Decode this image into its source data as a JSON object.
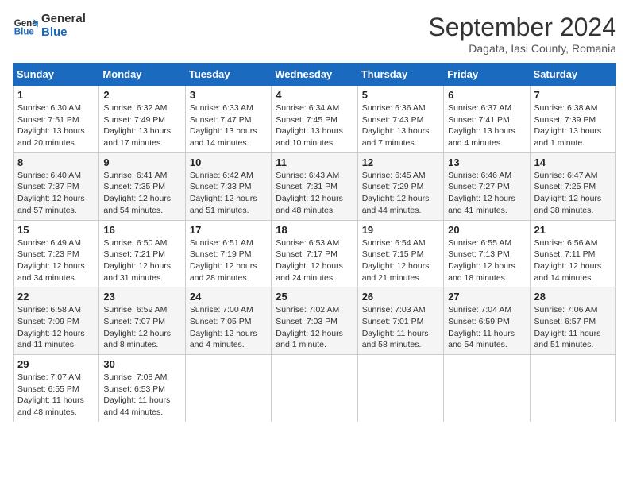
{
  "header": {
    "logo_general": "General",
    "logo_blue": "Blue",
    "month_title": "September 2024",
    "location": "Dagata, Iasi County, Romania"
  },
  "weekdays": [
    "Sunday",
    "Monday",
    "Tuesday",
    "Wednesday",
    "Thursday",
    "Friday",
    "Saturday"
  ],
  "weeks": [
    [
      {
        "day": "1",
        "info": "Sunrise: 6:30 AM\nSunset: 7:51 PM\nDaylight: 13 hours\nand 20 minutes."
      },
      {
        "day": "2",
        "info": "Sunrise: 6:32 AM\nSunset: 7:49 PM\nDaylight: 13 hours\nand 17 minutes."
      },
      {
        "day": "3",
        "info": "Sunrise: 6:33 AM\nSunset: 7:47 PM\nDaylight: 13 hours\nand 14 minutes."
      },
      {
        "day": "4",
        "info": "Sunrise: 6:34 AM\nSunset: 7:45 PM\nDaylight: 13 hours\nand 10 minutes."
      },
      {
        "day": "5",
        "info": "Sunrise: 6:36 AM\nSunset: 7:43 PM\nDaylight: 13 hours\nand 7 minutes."
      },
      {
        "day": "6",
        "info": "Sunrise: 6:37 AM\nSunset: 7:41 PM\nDaylight: 13 hours\nand 4 minutes."
      },
      {
        "day": "7",
        "info": "Sunrise: 6:38 AM\nSunset: 7:39 PM\nDaylight: 13 hours\nand 1 minute."
      }
    ],
    [
      {
        "day": "8",
        "info": "Sunrise: 6:40 AM\nSunset: 7:37 PM\nDaylight: 12 hours\nand 57 minutes."
      },
      {
        "day": "9",
        "info": "Sunrise: 6:41 AM\nSunset: 7:35 PM\nDaylight: 12 hours\nand 54 minutes."
      },
      {
        "day": "10",
        "info": "Sunrise: 6:42 AM\nSunset: 7:33 PM\nDaylight: 12 hours\nand 51 minutes."
      },
      {
        "day": "11",
        "info": "Sunrise: 6:43 AM\nSunset: 7:31 PM\nDaylight: 12 hours\nand 48 minutes."
      },
      {
        "day": "12",
        "info": "Sunrise: 6:45 AM\nSunset: 7:29 PM\nDaylight: 12 hours\nand 44 minutes."
      },
      {
        "day": "13",
        "info": "Sunrise: 6:46 AM\nSunset: 7:27 PM\nDaylight: 12 hours\nand 41 minutes."
      },
      {
        "day": "14",
        "info": "Sunrise: 6:47 AM\nSunset: 7:25 PM\nDaylight: 12 hours\nand 38 minutes."
      }
    ],
    [
      {
        "day": "15",
        "info": "Sunrise: 6:49 AM\nSunset: 7:23 PM\nDaylight: 12 hours\nand 34 minutes."
      },
      {
        "day": "16",
        "info": "Sunrise: 6:50 AM\nSunset: 7:21 PM\nDaylight: 12 hours\nand 31 minutes."
      },
      {
        "day": "17",
        "info": "Sunrise: 6:51 AM\nSunset: 7:19 PM\nDaylight: 12 hours\nand 28 minutes."
      },
      {
        "day": "18",
        "info": "Sunrise: 6:53 AM\nSunset: 7:17 PM\nDaylight: 12 hours\nand 24 minutes."
      },
      {
        "day": "19",
        "info": "Sunrise: 6:54 AM\nSunset: 7:15 PM\nDaylight: 12 hours\nand 21 minutes."
      },
      {
        "day": "20",
        "info": "Sunrise: 6:55 AM\nSunset: 7:13 PM\nDaylight: 12 hours\nand 18 minutes."
      },
      {
        "day": "21",
        "info": "Sunrise: 6:56 AM\nSunset: 7:11 PM\nDaylight: 12 hours\nand 14 minutes."
      }
    ],
    [
      {
        "day": "22",
        "info": "Sunrise: 6:58 AM\nSunset: 7:09 PM\nDaylight: 12 hours\nand 11 minutes."
      },
      {
        "day": "23",
        "info": "Sunrise: 6:59 AM\nSunset: 7:07 PM\nDaylight: 12 hours\nand 8 minutes."
      },
      {
        "day": "24",
        "info": "Sunrise: 7:00 AM\nSunset: 7:05 PM\nDaylight: 12 hours\nand 4 minutes."
      },
      {
        "day": "25",
        "info": "Sunrise: 7:02 AM\nSunset: 7:03 PM\nDaylight: 12 hours\nand 1 minute."
      },
      {
        "day": "26",
        "info": "Sunrise: 7:03 AM\nSunset: 7:01 PM\nDaylight: 11 hours\nand 58 minutes."
      },
      {
        "day": "27",
        "info": "Sunrise: 7:04 AM\nSunset: 6:59 PM\nDaylight: 11 hours\nand 54 minutes."
      },
      {
        "day": "28",
        "info": "Sunrise: 7:06 AM\nSunset: 6:57 PM\nDaylight: 11 hours\nand 51 minutes."
      }
    ],
    [
      {
        "day": "29",
        "info": "Sunrise: 7:07 AM\nSunset: 6:55 PM\nDaylight: 11 hours\nand 48 minutes."
      },
      {
        "day": "30",
        "info": "Sunrise: 7:08 AM\nSunset: 6:53 PM\nDaylight: 11 hours\nand 44 minutes."
      },
      null,
      null,
      null,
      null,
      null
    ]
  ]
}
